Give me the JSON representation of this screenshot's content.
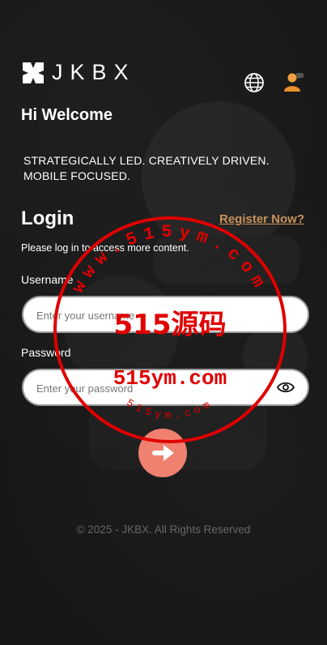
{
  "header": {
    "brand": "JKBX",
    "icons": [
      "globe-icon",
      "user-avatar-icon"
    ]
  },
  "welcome": {
    "title": "Hi Welcome",
    "tagline_line1": "STRATEGICALLY LED. CREATIVELY DRIVEN.",
    "tagline_line2": "MOBILE FOCUSED."
  },
  "login": {
    "title": "Login",
    "register_link": "Register Now?",
    "subtext": "Please log in to access more content.",
    "username_label": "Username",
    "username_placeholder": "Enter your username",
    "password_label": "Password",
    "password_placeholder": "Enter your password",
    "submit_icon": "arrow-right-icon"
  },
  "footer": {
    "copyright": "© 2025 - JKBX. All Rights Reserved"
  },
  "watermark": {
    "top_arc": "www.515ym.com",
    "center_cn": "515源码",
    "center_url": "515ym.com",
    "bottom_arc": "515ym.com"
  },
  "colors": {
    "background": "#161616",
    "accent_link": "#c9925a",
    "submit_button": "#f08070",
    "watermark": "#e00000"
  }
}
